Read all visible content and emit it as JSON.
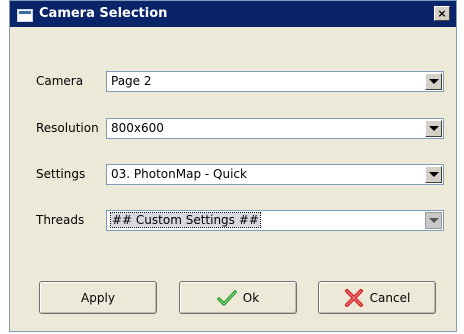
{
  "window": {
    "title": "Camera Selection",
    "close_label": "×"
  },
  "fields": [
    {
      "label": "Camera",
      "value": "Page 2"
    },
    {
      "label": "Resolution",
      "value": "800x600"
    },
    {
      "label": "Settings",
      "value": "03. PhotonMap - Quick"
    },
    {
      "label": "Threads",
      "value": "## Custom Settings ##"
    }
  ],
  "buttons": {
    "apply": "Apply",
    "ok": "Ok",
    "cancel": "Cancel"
  },
  "icons": {
    "ok": "checkmark-icon",
    "cancel": "x-icon",
    "app": "window-icon"
  },
  "colors": {
    "titlebar": "#0a246a",
    "dialog_bg": "#ece9d8",
    "check": "#2e9c2e",
    "cross": "#d62828"
  }
}
